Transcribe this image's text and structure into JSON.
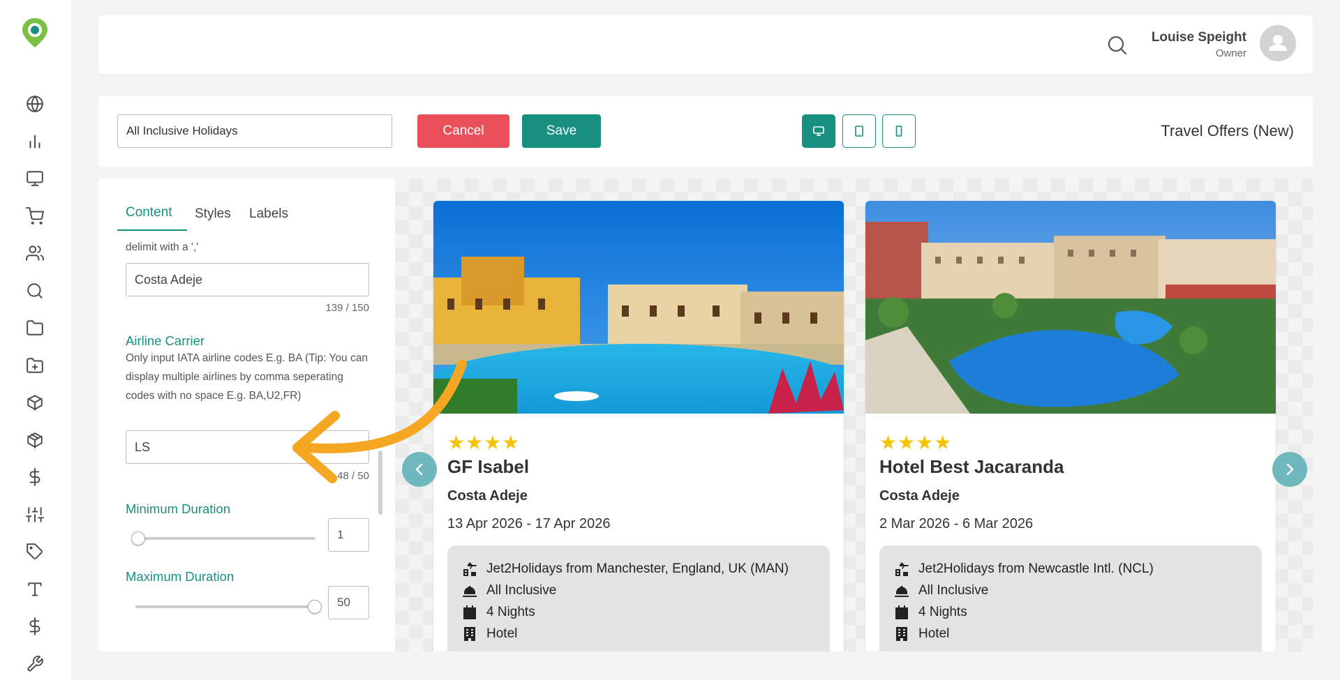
{
  "sidebar": {
    "icons": [
      "globe-icon",
      "bar-chart-icon",
      "monitor-icon",
      "cart-icon",
      "users-icon",
      "search-icon",
      "folder-icon",
      "folder-plus-icon",
      "box-icon",
      "package-icon",
      "dollar-icon",
      "sliders-icon",
      "tag-icon",
      "type-icon",
      "dollar-icon",
      "wrench-icon"
    ]
  },
  "header": {
    "user_name": "Louise Speight",
    "user_role": "Owner"
  },
  "toolbar": {
    "name_value": "All Inclusive Holidays",
    "cancel_label": "Cancel",
    "save_label": "Save",
    "title": "Travel Offers (New)",
    "active_device": "desktop"
  },
  "panel": {
    "tabs": [
      {
        "label": "Content",
        "active": true
      },
      {
        "label": "Styles",
        "active": false
      },
      {
        "label": "Labels",
        "active": false
      }
    ],
    "delimit_hint": "delimit with a ','",
    "destination_value": "Costa Adeje",
    "destination_counter": "139 / 150",
    "airline_label": "Airline Carrier",
    "airline_hint": "Only input IATA airline codes E.g. BA (Tip: You can display multiple airlines by comma seperating codes with no space E.g. BA,U2,FR)",
    "airline_value": "LS",
    "airline_counter": "48 / 50",
    "min_duration_label": "Minimum Duration",
    "min_duration_value": "1",
    "max_duration_label": "Maximum Duration",
    "max_duration_value": "50"
  },
  "offers": [
    {
      "stars": "★★★★",
      "hotel": "GF Isabel",
      "resort": "Costa Adeje",
      "dates": "13 Apr 2026 - 17 Apr 2026",
      "provider": "Jet2Holidays from Manchester, England, UK (MAN)",
      "board": "All Inclusive",
      "nights": "4 Nights",
      "type": "Hotel"
    },
    {
      "stars": "★★★★",
      "hotel": "Hotel Best Jacaranda",
      "resort": "Costa Adeje",
      "dates": "2 Mar 2026 - 6 Mar 2026",
      "provider": "Jet2Holidays from Newcastle Intl. (NCL)",
      "board": "All Inclusive",
      "nights": "4 Nights",
      "type": "Hotel"
    }
  ],
  "colors": {
    "accent": "#17907f",
    "cancel": "#e9505a",
    "star": "#f5c400",
    "annotation": "#f5a623"
  }
}
